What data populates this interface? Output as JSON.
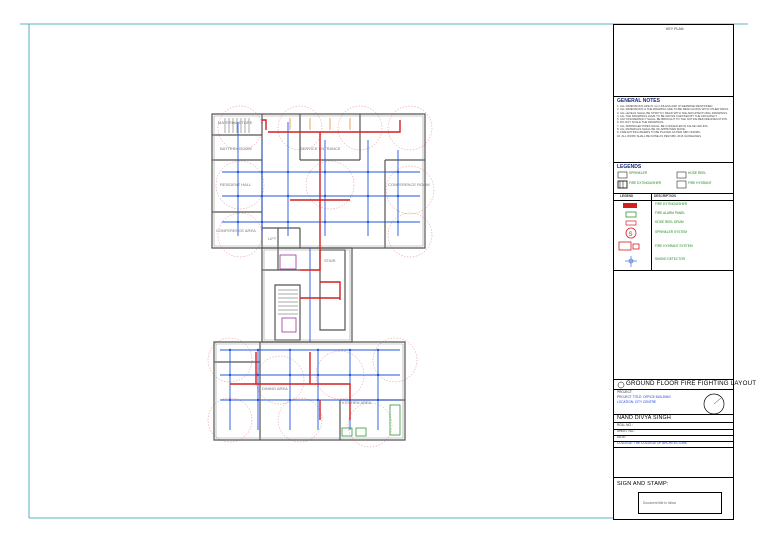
{
  "sheet": {
    "key_plan_label": "KEY PLAN",
    "general_notes": {
      "heading": "GENERAL NOTES",
      "items": [
        "1. ALL DIMENSIONS ARE IN mm UNLESS AND OTHERWISE MENTIONED.",
        "2. ALL DIMENSIONS & THE DRAWING ARE TO BE READ ALONG WITH OTHER DRGS.",
        "3. ALL LEVELS SHALL BE STRICTLY READ WITH THE ARCHITECTURAL DRAWINGS.",
        "4. ALL THE DRAWINGS HAVE TO BE CROSS CHECKED BY THE ARCHITECT.",
        "5. ANY DISCREPANCY SHALL BE BROUGHT TO THE NOTICE BEFORE EXECUTION.",
        "6. DO NOT SCALE THE DRAWINGS.",
        "7. ALL SPRINKLER PIPES SHALL BE CONCEALED IN FALSE CEILING.",
        "8. ALL MATERIALS SHALL BE OF APPROVED MAKE.",
        "9. FIRE EXTINGUISHERS TO BE PLACED AS PER NBC NORMS.",
        "10. ALL WORK SHALL BE DONE AS PER NBC 2016 GUIDELINES."
      ]
    },
    "legends": {
      "heading": "LEGENDS",
      "top_items": [
        "SPRINKLER",
        "FIRE EXTINGUISHER",
        "HOSE REEL",
        "FIRE HYDRANT"
      ],
      "table_headers": [
        "LEGEND",
        "DESCRIPTION"
      ],
      "rows": [
        {
          "desc": "FIRE EXTINGUISHER",
          "color": "#d41f1f"
        },
        {
          "desc": "FIRE ALARM PANEL",
          "color": "#1a8a1a"
        },
        {
          "desc": "HOSE REEL DRUM",
          "color": "#1a8a1a"
        },
        {
          "desc": "SPRINKLER SYSTEM",
          "color": "#d41f1f"
        },
        {
          "desc": "FIRE HYDRANT SYSTEM",
          "color": "#1a8a1a"
        },
        {
          "desc": "SMOKE DETECTOR",
          "color": "#1a8a1a"
        }
      ]
    },
    "drawing_title": "GROUND FLOOR FIRE FIGHTING LAYOUT",
    "project_lines": [
      "PROJECT:",
      "PROJECT TITLE: OFFICE BUILDING",
      "LOCATION: CITY CENTRE"
    ],
    "name": "NAND DIVYA SINGH",
    "info_lines": [
      "ROLL NO.:",
      "SHEET NO.:",
      "DATE:",
      "COLLEGE: THE COLLEGE OF ARCHITECTURE"
    ],
    "sign_label": "SIGN AND STAMP:",
    "stamp_text": "Document title to follow",
    "room_labels": [
      "MATERIAL STORE",
      "BATTERY ROOM",
      "RESIDENT HALL",
      "SERVICE ENTRANCE",
      "CONFERENCE ROOM",
      "CONFERENCE AREA",
      "DINING AREA",
      "KITCHEN AREA",
      "LIFT",
      "STAIR"
    ],
    "colors": {
      "border": "#2a9ab0",
      "sprinkler_pipe": "#2255dd",
      "main_pipe": "#d41f1f",
      "coverage": "#d41f1f",
      "wall": "#555555",
      "brick": "#c96a3a"
    }
  }
}
